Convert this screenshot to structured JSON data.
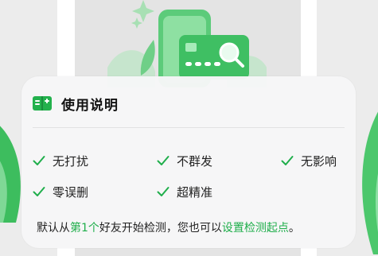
{
  "card": {
    "title": "使用说明",
    "features": [
      {
        "label": "无打扰"
      },
      {
        "label": "不群发"
      },
      {
        "label": "无影响"
      },
      {
        "label": "零误删"
      },
      {
        "label": "超精准"
      }
    ],
    "note": {
      "prefix": "默认从",
      "highlight": "第1个",
      "middle": "好友开始检测，您也可以",
      "link": "设置检测起点",
      "suffix": "。"
    }
  },
  "colors": {
    "accent": "#1fae4b",
    "card_bg": "#f6f6f7"
  },
  "icons": {
    "title_icon": "book-icon",
    "feature_icon": "check-icon"
  }
}
